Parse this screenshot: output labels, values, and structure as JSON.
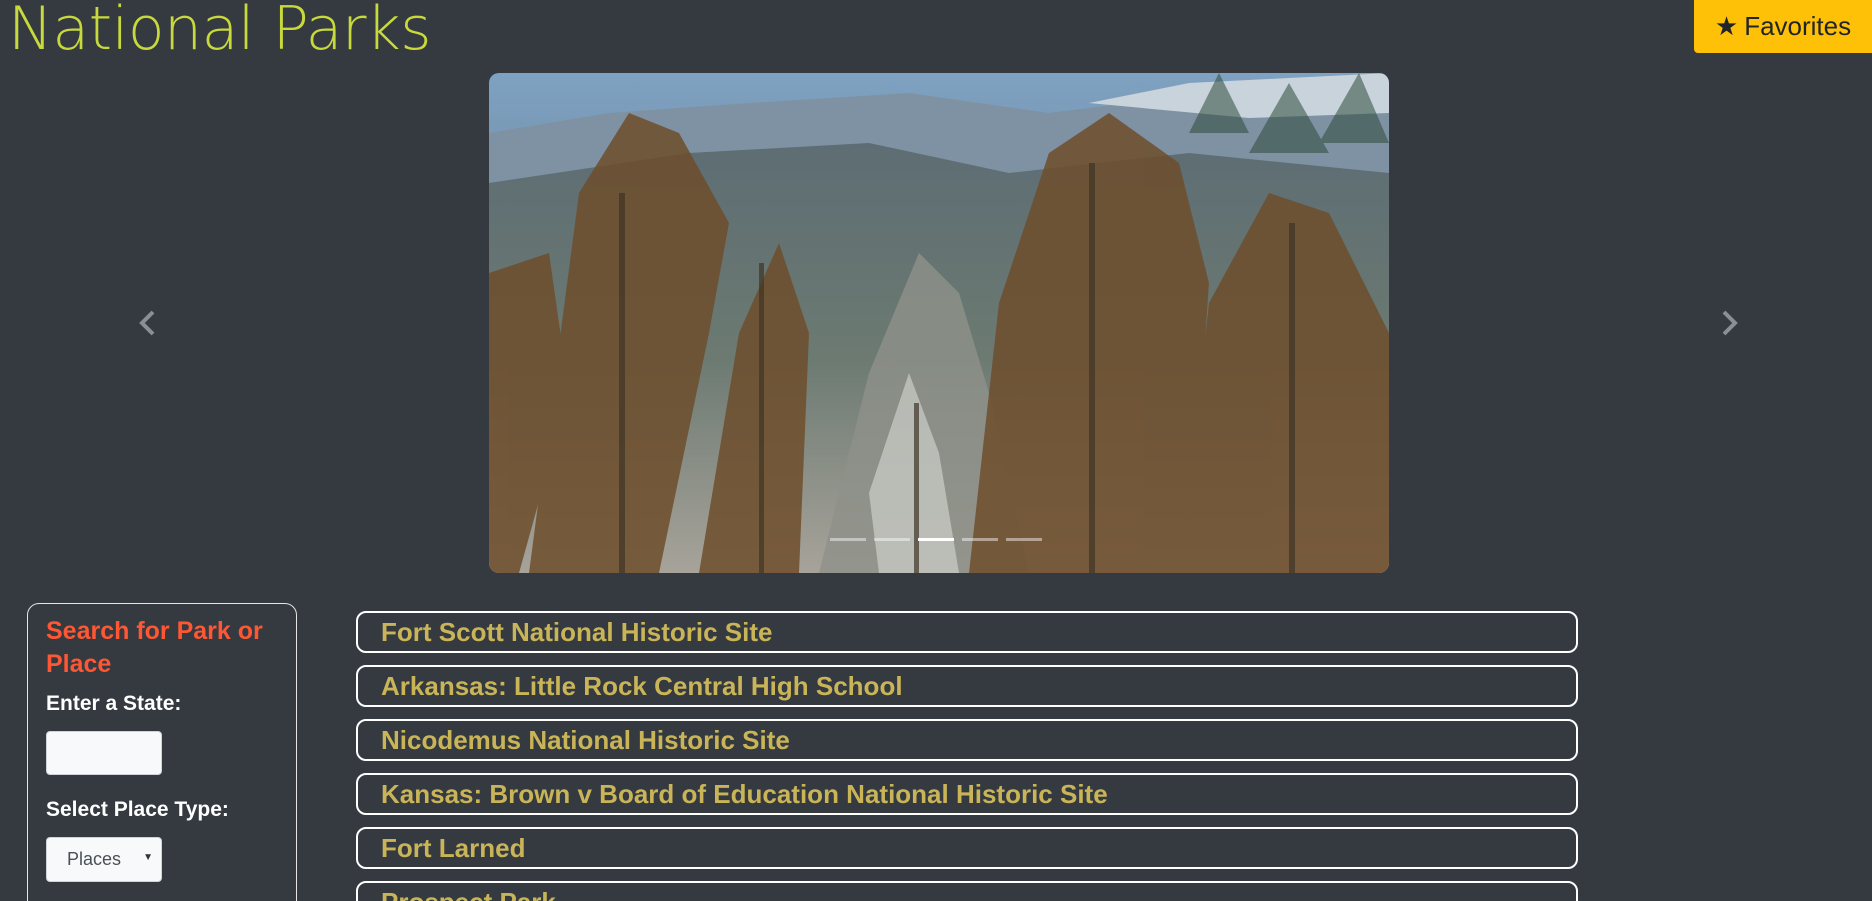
{
  "header": {
    "title": "National Parks",
    "favorites_label": "Favorites",
    "favorites_icon": "star-icon"
  },
  "carousel": {
    "prev_icon": "chevron-left-icon",
    "next_icon": "chevron-right-icon",
    "slide_count": 5,
    "active_index": 2,
    "image_subject": "mountain-forest-photo"
  },
  "search": {
    "title": "Search for Park or Place",
    "state_label": "Enter a State:",
    "state_value": "",
    "type_label": "Select Place Type:",
    "type_selected": "Places"
  },
  "results": [
    "Fort Scott National Historic Site",
    "Arkansas: Little Rock Central High School",
    "Nicodemus National Historic Site",
    "Kansas: Brown v Board of Education National Historic Site",
    "Fort Larned",
    "Prospect Park"
  ],
  "colors": {
    "background": "#343a40",
    "title": "#c8d93c",
    "favorites_bg": "#ffc107",
    "search_title": "#ff5733",
    "result_text": "#c9b458"
  }
}
